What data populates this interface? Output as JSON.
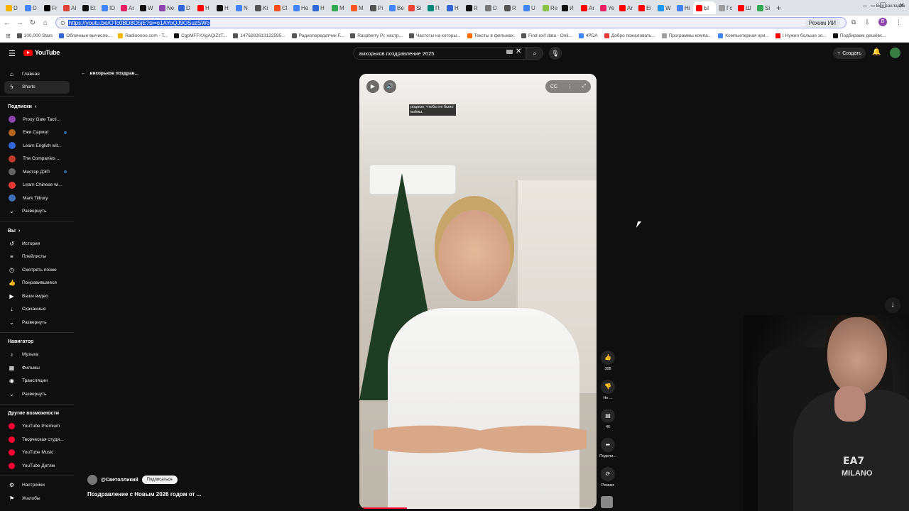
{
  "browser": {
    "tab_colors": [
      "#f5b400",
      "#4285f4",
      "#000000",
      "#db4437",
      "#111111",
      "#4285f4",
      "#e91e63",
      "#111111",
      "#8e44ad",
      "#3367d6",
      "#ff0000",
      "#111111",
      "#4285f4",
      "#555555",
      "#f4511e",
      "#4285f4",
      "#3367d6",
      "#34a853",
      "#ff5722",
      "#555555",
      "#4285f4",
      "#ea4335",
      "#00897b",
      "#3367d6",
      "#111111",
      "#777777",
      "#555555",
      "#4285f4",
      "#8bc34a",
      "#111111",
      "#ff0000",
      "#e91e63",
      "#ff0000",
      "#ff0000",
      "#2196f3",
      "#4285f4",
      "#ff0000",
      "#9e9e9e",
      "#ff0000",
      "#34a853"
    ],
    "tab_letters": [
      "D",
      "D",
      "Fr",
      "AI",
      "Et",
      "ID",
      "Ar",
      "W",
      "Ne",
      "D",
      "H",
      "H",
      "N",
      "Ki",
      "Cl",
      "He",
      "H",
      "M",
      "M",
      "Pi",
      "Be",
      "Si",
      "П",
      "H",
      "R",
      "D",
      "R",
      "U",
      "Re",
      "И",
      "Ar",
      "Ye",
      "Ar",
      "Ei",
      "W",
      "Hi",
      "Ы",
      "Гс",
      "Ш",
      "Si"
    ],
    "url": "https://youtu.be/OTc0BD8O5jE?si=o1AYoQJ9OSuzSWo",
    "ai_mode_label": "Режим ИИ",
    "profile_letter": "B",
    "bookmarks": [
      {
        "label": "100,000 Stars",
        "color": "#555"
      },
      {
        "label": "Облачные вычисле...",
        "color": "#3367d6"
      },
      {
        "label": "Radiooooo.com - T...",
        "color": "#f5b400"
      },
      {
        "label": "CgpMFFXXgAQiZzT...",
        "color": "#111"
      },
      {
        "label": "1476282613122595...",
        "color": "#555"
      },
      {
        "label": "Радиопередатчик F...",
        "color": "#555"
      },
      {
        "label": "Raspberry Pi: настр...",
        "color": "#555"
      },
      {
        "label": "Частоты на которы...",
        "color": "#555"
      },
      {
        "label": "Тексты в фильмах.",
        "color": "#ff6d00"
      },
      {
        "label": "Find exif data - Onli...",
        "color": "#555"
      },
      {
        "label": "4PDA",
        "color": "#4285f4"
      },
      {
        "label": "Добро пожаловать...",
        "color": "#e53935"
      },
      {
        "label": "Программы компа...",
        "color": "#9e9e9e"
      },
      {
        "label": "Компьютерная кри...",
        "color": "#4285f4"
      },
      {
        "label": "I Нужно больше зо...",
        "color": "#ff0000"
      },
      {
        "label": "Подбираем дешёвс...",
        "color": "#111"
      }
    ],
    "all_bookmarks_label": "Все закладки"
  },
  "youtube": {
    "logo_text": "YouTube",
    "search_query": "вихорьков поздравление 2025",
    "create_label": "Создать",
    "back_label": "вихорьков поздрав...",
    "sidebar": {
      "main": [
        {
          "label": "Главная",
          "icon": "⌂"
        },
        {
          "label": "Shorts",
          "icon": "ϟ"
        }
      ],
      "subs_title": "Подписки",
      "subscriptions": [
        {
          "label": "Proxy Gate Tacti...",
          "color": "#8e44ad"
        },
        {
          "label": "Ежи Сармат",
          "color": "#b5651d"
        },
        {
          "label": "Learn English wit...",
          "color": "#3367d6"
        },
        {
          "label": "The Companies ...",
          "color": "#c0392b"
        },
        {
          "label": "Мистер ДЭП",
          "color": "#666"
        },
        {
          "label": "Learn Chinese wi...",
          "color": "#e53935"
        },
        {
          "label": "Mark Tilbury",
          "color": "#3f6fb5"
        }
      ],
      "expand_label": "Развернуть",
      "you_title": "Вы",
      "you_items": [
        {
          "label": "История",
          "icon": "↺"
        },
        {
          "label": "Плейлисты",
          "icon": "≡"
        },
        {
          "label": "Смотреть позже",
          "icon": "◷"
        },
        {
          "label": "Понравившиеся",
          "icon": "👍"
        },
        {
          "label": "Ваши видео",
          "icon": "▶"
        },
        {
          "label": "Скачанные",
          "icon": "↓"
        },
        {
          "label": "Развернуть",
          "icon": "⌄"
        }
      ],
      "nav_title": "Навигатор",
      "nav_items": [
        {
          "label": "Музыка",
          "icon": "♪"
        },
        {
          "label": "Фильмы",
          "icon": "▦"
        },
        {
          "label": "Трансляции",
          "icon": "◉"
        },
        {
          "label": "Развернуть",
          "icon": "⌄"
        }
      ],
      "more_title": "Другие возможности",
      "more_items": [
        {
          "label": "YouTube Premium"
        },
        {
          "label": "Творческая студи..."
        },
        {
          "label": "YouTube Music"
        },
        {
          "label": "YouTube Детям"
        }
      ],
      "bottom_items": [
        {
          "label": "Настройки",
          "icon": "⚙"
        },
        {
          "label": "Жалобы",
          "icon": "⚑"
        }
      ]
    },
    "player": {
      "caption": "родные, чтобы не было войны.",
      "progress": 0.2
    },
    "actions": {
      "likes": "308",
      "dislike_label": "Не ...",
      "comments": "46",
      "share_label": "Подели...",
      "remix_label": "Ремикс"
    },
    "channel": {
      "name": "@Светолликий",
      "subscribe_label": "Подписаться"
    },
    "short_title": "Поздравление с Новым 2026 годом от ...",
    "webcam_shirt_text": "EA7",
    "webcam_shirt_subtext": "MILANO"
  }
}
